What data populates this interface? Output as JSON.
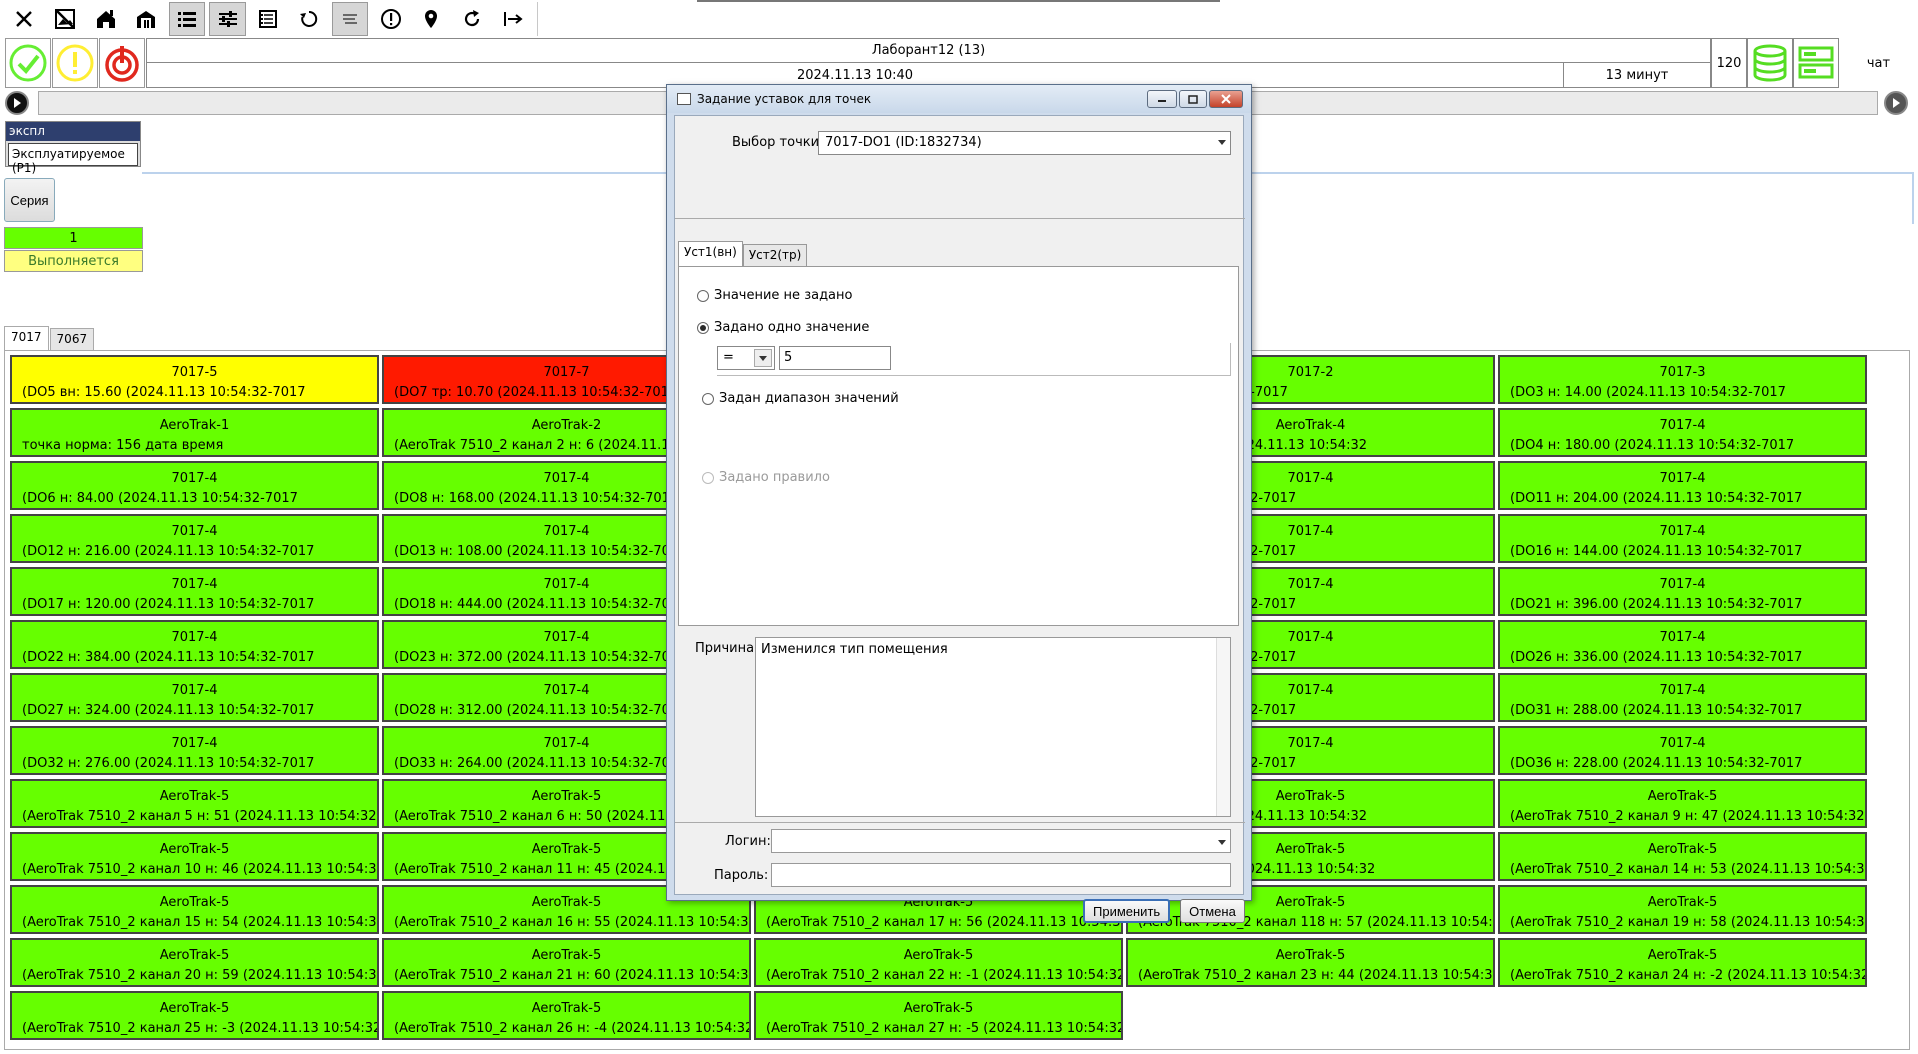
{
  "toolbar": {
    "icons": [
      "close-icon",
      "image-off-icon",
      "home-icon",
      "building-icon",
      "list-icon",
      "sliders-icon",
      "table-icon",
      "history-icon",
      "notes-icon",
      "alert-icon",
      "location-pin-icon",
      "refresh-icon",
      "logout-icon"
    ],
    "active": [
      "list-icon",
      "sliders-icon",
      "notes-icon"
    ]
  },
  "header": {
    "user": "Лаборант12 (13)",
    "datetime": "2024.11.13  10:40",
    "duration": "13 минут",
    "count": "120",
    "chat": "чат"
  },
  "colors": {
    "ok": "#66ff00",
    "alarm": "#ff1a00",
    "warning": "#ffff00",
    "accent": "#2e3f6e"
  },
  "mode": {
    "selected_label": "экспл",
    "option_label": "Эксплуатируемое (P1)"
  },
  "series": {
    "button_label": "Серия",
    "run_number": "1",
    "run_status": "Выполняется"
  },
  "tabs": [
    {
      "label": "7017",
      "selected": true
    },
    {
      "label": "7067",
      "selected": false
    }
  ],
  "grid": [
    {
      "title": "7017-5",
      "detail": "(DO5 вн: 15.60 (2024.11.13 10:54:32-7017",
      "status": "warning"
    },
    {
      "title": "7017-7",
      "detail": "(DO7 тр: 10.70 (2024.11.13 10:54:32-7017",
      "status": "alarm"
    },
    {
      "title": "",
      "detail": "",
      "status": "hidden"
    },
    {
      "title": "7017-2",
      "detail": "4.11.13 10:54:32-7017",
      "status": "ok"
    },
    {
      "title": "7017-3",
      "detail": "(DO3 н: 14.00 (2024.11.13 10:54:32-7017",
      "status": "ok"
    },
    {
      "title": "AeroTrak-1",
      "detail": "точка норма: 156 дата время",
      "status": "ok"
    },
    {
      "title": "AeroTrak-2",
      "detail": "(AeroTrak 7510_2 канал 2 н: 6 (2024.11.13 10:5",
      "status": "ok"
    },
    {
      "title": "",
      "detail": "",
      "status": "hidden"
    },
    {
      "title": "AeroTrak-4",
      "detail": "анал 4 н: 11 (2024.11.13 10:54:32",
      "status": "ok"
    },
    {
      "title": "7017-4",
      "detail": "(DO4 н: 180.00 (2024.11.13 10:54:32-7017",
      "status": "ok"
    },
    {
      "title": "7017-4",
      "detail": "(DO6 н: 84.00 (2024.11.13 10:54:32-7017",
      "status": "ok"
    },
    {
      "title": "7017-4",
      "detail": "(DO8 н: 168.00 (2024.11.13 10:54:32-7017",
      "status": "ok"
    },
    {
      "title": "",
      "detail": "",
      "status": "hidden"
    },
    {
      "title": "7017-4",
      "detail": "24.11.13 10:54:32-7017",
      "status": "ok"
    },
    {
      "title": "7017-4",
      "detail": "(DO11 н: 204.00 (2024.11.13 10:54:32-7017",
      "status": "ok"
    },
    {
      "title": "7017-4",
      "detail": "(DO12 н: 216.00 (2024.11.13 10:54:32-7017",
      "status": "ok"
    },
    {
      "title": "7017-4",
      "detail": "(DO13 н: 108.00 (2024.11.13 10:54:32-7017",
      "status": "ok"
    },
    {
      "title": "",
      "detail": "",
      "status": "hidden"
    },
    {
      "title": "7017-4",
      "detail": "24.11.13 10:54:32-7017",
      "status": "ok"
    },
    {
      "title": "7017-4",
      "detail": "(DO16 н: 144.00 (2024.11.13 10:54:32-7017",
      "status": "ok"
    },
    {
      "title": "7017-4",
      "detail": "(DO17 н: 120.00 (2024.11.13 10:54:32-7017",
      "status": "ok"
    },
    {
      "title": "7017-4",
      "detail": "(DO18 н: 444.00 (2024.11.13 10:54:32-7017",
      "status": "ok"
    },
    {
      "title": "",
      "detail": "",
      "status": "hidden"
    },
    {
      "title": "7017-4",
      "detail": "24.11.13 10:54:32-7017",
      "status": "ok"
    },
    {
      "title": "7017-4",
      "detail": "(DO21 н: 396.00 (2024.11.13 10:54:32-7017",
      "status": "ok"
    },
    {
      "title": "7017-4",
      "detail": "(DO22 н: 384.00 (2024.11.13 10:54:32-7017",
      "status": "ok"
    },
    {
      "title": "7017-4",
      "detail": "(DO23 н: 372.00 (2024.11.13 10:54:32-7017",
      "status": "ok"
    },
    {
      "title": "",
      "detail": "",
      "status": "hidden"
    },
    {
      "title": "7017-4",
      "detail": "24.11.13 10:54:32-7017",
      "status": "ok"
    },
    {
      "title": "7017-4",
      "detail": "(DO26 н: 336.00 (2024.11.13 10:54:32-7017",
      "status": "ok"
    },
    {
      "title": "7017-4",
      "detail": "(DO27 н: 324.00 (2024.11.13 10:54:32-7017",
      "status": "ok"
    },
    {
      "title": "7017-4",
      "detail": "(DO28 н: 312.00 (2024.11.13 10:54:32-7017",
      "status": "ok"
    },
    {
      "title": "",
      "detail": "",
      "status": "hidden"
    },
    {
      "title": "7017-4",
      "detail": "24.11.13 10:54:32-7017",
      "status": "ok"
    },
    {
      "title": "7017-4",
      "detail": "(DO31 н: 288.00 (2024.11.13 10:54:32-7017",
      "status": "ok"
    },
    {
      "title": "7017-4",
      "detail": "(DO32 н: 276.00 (2024.11.13 10:54:32-7017",
      "status": "ok"
    },
    {
      "title": "7017-4",
      "detail": "(DO33 н: 264.00 (2024.11.13 10:54:32-7017",
      "status": "ok"
    },
    {
      "title": "",
      "detail": "",
      "status": "hidden"
    },
    {
      "title": "7017-4",
      "detail": "24.11.13 10:54:32-7017",
      "status": "ok"
    },
    {
      "title": "7017-4",
      "detail": "(DO36 н: 228.00 (2024.11.13 10:54:32-7017",
      "status": "ok"
    },
    {
      "title": "AeroTrak-5",
      "detail": "(AeroTrak 7510_2 канал 5 н: 51 (2024.11.13 10:54:32",
      "status": "ok"
    },
    {
      "title": "AeroTrak-5",
      "detail": "(AeroTrak 7510_2 канал 6 н: 50 (2024.11.13 1",
      "status": "ok"
    },
    {
      "title": "",
      "detail": "",
      "status": "hidden"
    },
    {
      "title": "AeroTrak-5",
      "detail": "анал 8 н: 48 (2024.11.13 10:54:32",
      "status": "ok"
    },
    {
      "title": "AeroTrak-5",
      "detail": "(AeroTrak 7510_2 канал 9 н: 47 (2024.11.13 10:54:32",
      "status": "ok"
    },
    {
      "title": "AeroTrak-5",
      "detail": "(AeroTrak 7510_2 канал 10 н: 46 (2024.11.13 10:54:32",
      "status": "ok"
    },
    {
      "title": "AeroTrak-5",
      "detail": "(AeroTrak 7510_2 канал 11 н: 45 (2024.11.13 1",
      "status": "ok"
    },
    {
      "title": "",
      "detail": "",
      "status": "hidden"
    },
    {
      "title": "AeroTrak-5",
      "detail": "анал 12 н: 43 (2024.11.13 10:54:32",
      "status": "ok"
    },
    {
      "title": "AeroTrak-5",
      "detail": "(AeroTrak 7510_2 канал 14 н: 53 (2024.11.13 10:54:32",
      "status": "ok"
    },
    {
      "title": "AeroTrak-5",
      "detail": "(AeroTrak 7510_2 канал 15 н: 54 (2024.11.13 10:54:32",
      "status": "ok"
    },
    {
      "title": "AeroTrak-5",
      "detail": "(AeroTrak 7510_2 канал 16 н: 55 (2024.11.13 10:54:32",
      "status": "ok"
    },
    {
      "title": "AeroTrak-5",
      "detail": "(AeroTrak 7510_2 канал 17 н: 56 (2024.11.13 10:54:32",
      "status": "ok"
    },
    {
      "title": "AeroTrak-5",
      "detail": "(AeroTrak 7510_2 канал 118 н: 57 (2024.11.13 10:54:32",
      "status": "ok"
    },
    {
      "title": "AeroTrak-5",
      "detail": "(AeroTrak 7510_2 канал 19 н: 58 (2024.11.13 10:54:32",
      "status": "ok"
    },
    {
      "title": "AeroTrak-5",
      "detail": "(AeroTrak 7510_2 канал 20 н: 59 (2024.11.13 10:54:32",
      "status": "ok"
    },
    {
      "title": "AeroTrak-5",
      "detail": "(AeroTrak 7510_2 канал 21 н: 60 (2024.11.13 10:54:32",
      "status": "ok"
    },
    {
      "title": "AeroTrak-5",
      "detail": "(AeroTrak 7510_2 канал 22 н: -1 (2024.11.13 10:54:32",
      "status": "ok"
    },
    {
      "title": "AeroTrak-5",
      "detail": "(AeroTrak 7510_2 канал 23 н: 44 (2024.11.13 10:54:32",
      "status": "ok"
    },
    {
      "title": "AeroTrak-5",
      "detail": "(AeroTrak 7510_2 канал 24 н: -2 (2024.11.13 10:54:32",
      "status": "ok"
    },
    {
      "title": "AeroTrak-5",
      "detail": "(AeroTrak 7510_2 канал 25 н: -3 (2024.11.13 10:54:32",
      "status": "ok"
    },
    {
      "title": "AeroTrak-5",
      "detail": "(AeroTrak 7510_2 канал 26 н: -4 (2024.11.13 10:54:32",
      "status": "ok"
    },
    {
      "title": "AeroTrak-5",
      "detail": "(AeroTrak 7510_2 канал 27 н: -5 (2024.11.13 10:54:32",
      "status": "ok"
    }
  ],
  "dialog": {
    "title": "Задание уставок для точек",
    "point_label": "Выбор точки:",
    "point_value": "7017-DO1 (ID:1832734)",
    "tabs": [
      "Уст1(вн)",
      "Уст2(тр)"
    ],
    "radio_none": "Значение не задано",
    "radio_single": "Задано одно значение",
    "operator": "=",
    "value": "5",
    "radio_range": "Задан диапазон значений",
    "radio_rule": "Задано правило",
    "reason_label": "Причина:",
    "reason_text": "Изменился тип помещения",
    "login_label": "Логин:",
    "login_value": "",
    "password_label": "Пароль:",
    "apply_label": "Применить",
    "cancel_label": "Отмена"
  }
}
